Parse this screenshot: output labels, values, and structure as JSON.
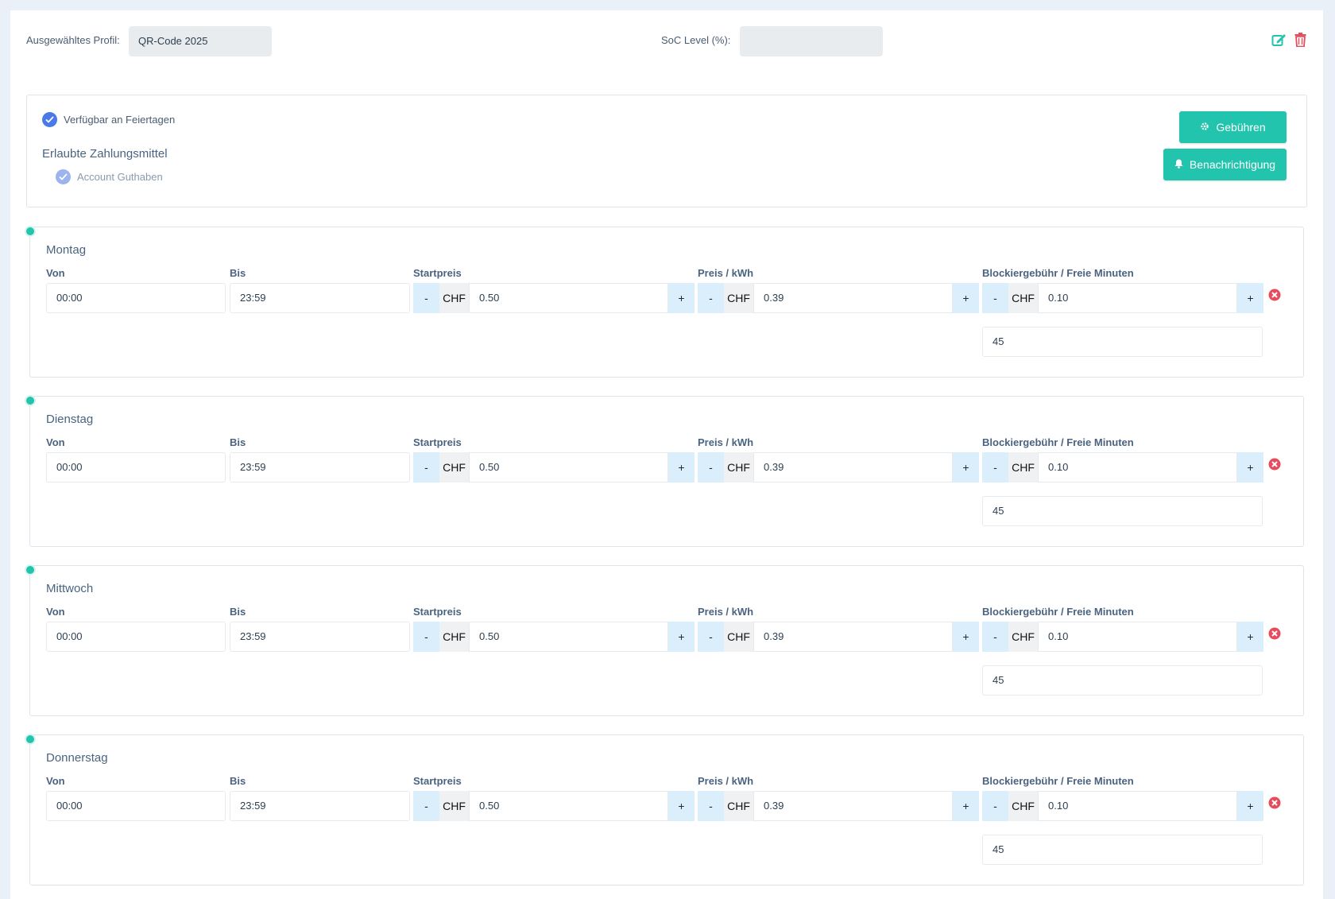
{
  "header": {
    "profile_label": "Ausgewähltes Profil:",
    "profile_value": "QR-Code 2025",
    "soc_label": "SoC Level (%):",
    "soc_value": "",
    "edit_icon": "edit-icon",
    "delete_icon": "trash-icon"
  },
  "settings": {
    "holiday_label": "Verfügbar an Feiertagen",
    "payment_title": "Erlaubte Zahlungsmittel",
    "payment_option": "Account Guthaben",
    "fees_button": "Gebühren",
    "notify_button": "Benachrichtigung"
  },
  "columns": {
    "from": "Von",
    "to": "Bis",
    "start_price": "Startpreis",
    "kwh_price": "Preis / kWh",
    "blocking": "Blockiergebühr / Freie Minuten"
  },
  "controls": {
    "minus": "-",
    "plus": "+",
    "currency": "CHF"
  },
  "days": [
    {
      "name": "Montag",
      "from": "00:00",
      "to": "23:59",
      "start_price": "0.50",
      "kwh_price": "0.39",
      "blocking_fee": "0.10",
      "free_minutes": "45"
    },
    {
      "name": "Dienstag",
      "from": "00:00",
      "to": "23:59",
      "start_price": "0.50",
      "kwh_price": "0.39",
      "blocking_fee": "0.10",
      "free_minutes": "45"
    },
    {
      "name": "Mittwoch",
      "from": "00:00",
      "to": "23:59",
      "start_price": "0.50",
      "kwh_price": "0.39",
      "blocking_fee": "0.10",
      "free_minutes": "45"
    },
    {
      "name": "Donnerstag",
      "from": "00:00",
      "to": "23:59",
      "start_price": "0.50",
      "kwh_price": "0.39",
      "blocking_fee": "0.10",
      "free_minutes": "45"
    }
  ],
  "colors": {
    "accent": "#22c4ad",
    "danger": "#e74c5c",
    "check": "#4a7ae8"
  }
}
